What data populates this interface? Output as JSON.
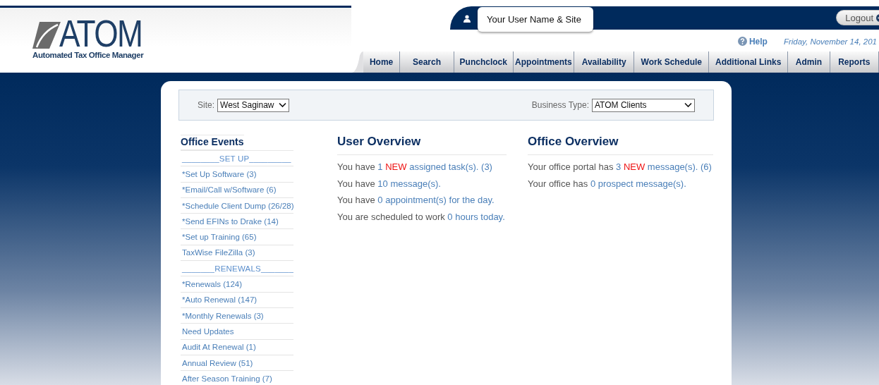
{
  "logo": {
    "wordmark": "ATOM",
    "tagline": "Automated Tax Office Manager"
  },
  "user_badge": "Your User Name & Site",
  "logout": "Logout",
  "help": "Help",
  "date": "Friday, November 14, 201",
  "nav": [
    {
      "label": "Home"
    },
    {
      "label": "Search"
    },
    {
      "label": "Punchclock"
    },
    {
      "label": "Appointments"
    },
    {
      "label": "Availability"
    },
    {
      "label": "Work Schedule"
    },
    {
      "label": "Additional Links"
    },
    {
      "label": "Admin"
    },
    {
      "label": "Reports"
    }
  ],
  "filters": [
    {
      "label": "Site:",
      "value": "West Saginaw"
    },
    {
      "label": "Business Type:",
      "value": "ATOM Clients"
    }
  ],
  "office_events": {
    "title": "Office Events",
    "items": [
      {
        "text": "________SET UP_________",
        "kind": "section"
      },
      {
        "text": "*Set Up Software (3)",
        "kind": "link"
      },
      {
        "text": "*Email/Call w/Software (6)",
        "kind": "link"
      },
      {
        "text": "*Schedule Client Dump (26/28)",
        "kind": "link"
      },
      {
        "text": "*Send EFINs to Drake (14)",
        "kind": "link"
      },
      {
        "text": "*Set up Training (65)",
        "kind": "link"
      },
      {
        "text": "TaxWise FileZilla (3)",
        "kind": "link"
      },
      {
        "text": "_______RENEWALS_______",
        "kind": "section"
      },
      {
        "text": "*Renewals (124)",
        "kind": "link"
      },
      {
        "text": "*Auto Renewal (147)",
        "kind": "link"
      },
      {
        "text": "*Monthly Renewals (3)",
        "kind": "link"
      },
      {
        "text": "Need Updates",
        "kind": "link"
      },
      {
        "text": "Audit At Renewal (1)",
        "kind": "link"
      },
      {
        "text": "Annual Review (51)",
        "kind": "link"
      },
      {
        "text": "After Season Training (7)",
        "kind": "link"
      }
    ]
  },
  "overviews": [
    {
      "title": "User Overview",
      "lines": [
        [
          {
            "text": "You have ",
            "kind": "plain"
          },
          {
            "text": "1",
            "kind": "link"
          },
          {
            "text": "NEW",
            "kind": "new"
          },
          {
            "text": "assigned task(s). (3)",
            "kind": "link"
          }
        ],
        [
          {
            "text": "You have ",
            "kind": "plain"
          },
          {
            "text": "10 message(s).",
            "kind": "link"
          }
        ],
        [
          {
            "text": "You have ",
            "kind": "plain"
          },
          {
            "text": "0 appointment(s) for the day.",
            "kind": "link"
          }
        ],
        [
          {
            "text": "You are scheduled to work ",
            "kind": "plain"
          },
          {
            "text": "0 hours today.",
            "kind": "link"
          }
        ]
      ]
    },
    {
      "title": "Office Overview",
      "lines": [
        [
          {
            "text": "Your office portal has ",
            "kind": "plain"
          },
          {
            "text": "3",
            "kind": "link"
          },
          {
            "text": "NEW",
            "kind": "new"
          },
          {
            "text": "message(s). (6)",
            "kind": "link"
          }
        ],
        [
          {
            "text": "Your office has ",
            "kind": "plain"
          },
          {
            "text": "0 prospect message(s).",
            "kind": "link"
          }
        ]
      ]
    }
  ]
}
